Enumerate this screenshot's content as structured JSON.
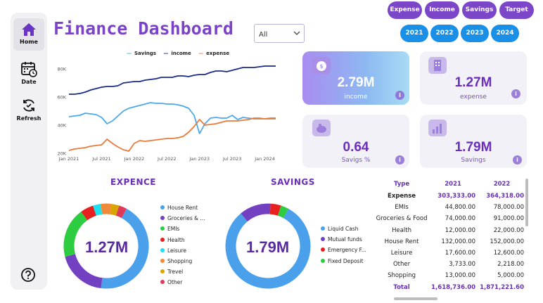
{
  "header": {
    "title": "Finance Dashboard",
    "year_select": "All"
  },
  "sidebar": {
    "items": [
      {
        "label": "Home",
        "icon": "home-icon"
      },
      {
        "label": "Date",
        "icon": "calendar-icon"
      },
      {
        "label": "Refresh",
        "icon": "refresh-icon"
      }
    ],
    "help_icon": "help-icon"
  },
  "nav_buttons": {
    "measures": [
      "Expense",
      "Income",
      "Savings",
      "Target"
    ],
    "years": [
      "2021",
      "2022",
      "2023",
      "2024"
    ]
  },
  "kpis": {
    "income": {
      "value": "2.79M",
      "label": "income"
    },
    "expense": {
      "value": "1.27M",
      "label": "expense"
    },
    "savings_pct": {
      "value": "0.64",
      "label": "Savigs %"
    },
    "savings": {
      "value": "1.79M",
      "label": "Savings"
    }
  },
  "chart_data": [
    {
      "type": "line",
      "title": "",
      "legend": [
        "Savings",
        "income",
        "expense"
      ],
      "colors": {
        "Savings": "#4aa8ec",
        "income": "#1a2b8a",
        "expense": "#ea7a3b"
      },
      "x": [
        "2021-01",
        "2021-02",
        "2021-03",
        "2021-04",
        "2021-05",
        "2021-06",
        "2021-07",
        "2021-08",
        "2021-09",
        "2021-10",
        "2021-11",
        "2021-12",
        "2022-01",
        "2022-02",
        "2022-03",
        "2022-04",
        "2022-05",
        "2022-06",
        "2022-07",
        "2022-08",
        "2022-09",
        "2022-10",
        "2022-11",
        "2022-12",
        "2023-01",
        "2023-02",
        "2023-03",
        "2023-04",
        "2023-05",
        "2023-06",
        "2023-07",
        "2023-08",
        "2023-09",
        "2023-10",
        "2023-11",
        "2023-12",
        "2024-01",
        "2024-02",
        "2024-03"
      ],
      "x_ticks": [
        "Jan 2021",
        "Jul 2021",
        "Jan 2022",
        "Jul 2022",
        "Jan 2023",
        "Jul 2023",
        "Jan 2024"
      ],
      "y_ticks": [
        "20K",
        "40K",
        "60K",
        "80K"
      ],
      "ylim": [
        20000,
        85000
      ],
      "series": [
        {
          "name": "income",
          "values": [
            62000,
            62000,
            62500,
            63500,
            65000,
            66000,
            67000,
            67500,
            67500,
            68000,
            70000,
            70500,
            71000,
            71000,
            72000,
            72500,
            73000,
            74000,
            74000,
            74000,
            75000,
            75000,
            74500,
            75500,
            76000,
            76000,
            77500,
            78500,
            78500,
            78000,
            79000,
            80000,
            81000,
            81000,
            81000,
            81500,
            82000,
            82000,
            82000
          ]
        },
        {
          "name": "Savings",
          "values": [
            46000,
            46500,
            47000,
            48500,
            48000,
            47500,
            45500,
            41000,
            43000,
            46500,
            50000,
            52000,
            53000,
            54000,
            55000,
            56000,
            55500,
            55500,
            55000,
            55000,
            54500,
            53500,
            52000,
            47000,
            34000,
            41000,
            45000,
            45500,
            45000,
            45000,
            47000,
            44000,
            45500,
            45000,
            44500,
            44500,
            44500,
            44500,
            44500
          ]
        },
        {
          "name": "expense",
          "values": [
            22000,
            23000,
            23500,
            24000,
            25000,
            25500,
            26000,
            30000,
            27000,
            24500,
            22500,
            21500,
            27000,
            29000,
            28500,
            29000,
            29500,
            30000,
            30500,
            30500,
            31000,
            32000,
            35000,
            39000,
            44000,
            40000,
            40500,
            41000,
            42000,
            43000,
            43000,
            43000,
            43500,
            44000,
            45000,
            45000,
            44500,
            45000,
            45000
          ]
        }
      ]
    },
    {
      "type": "pie",
      "title": "EXPENCE",
      "center_label": "1.27M",
      "labels": [
        "House Rent",
        "Groceries & ...",
        "EMIs",
        "Health",
        "Leisure",
        "Shopping",
        "Trevel",
        "Other"
      ],
      "values": [
        0.44,
        0.19,
        0.19,
        0.05,
        0.03,
        0.04,
        0.03,
        0.03
      ],
      "colors": [
        "#4aa0ea",
        "#7440c2",
        "#2ecc40",
        "#e82020",
        "#1de1f0",
        "#ef8a3a",
        "#d9a400",
        "#e03a5a"
      ]
    },
    {
      "type": "pie",
      "title": "SAVINGS",
      "center_label": "1.79M",
      "labels": [
        "Liquid Cash",
        "Mutual funds",
        "Emergency F...",
        "Fixed Deposit"
      ],
      "values": [
        0.81,
        0.12,
        0.04,
        0.03
      ],
      "colors": [
        "#4aa0ea",
        "#7440c2",
        "#e82020",
        "#2ecc40"
      ]
    }
  ],
  "table": {
    "headers": [
      "Type",
      "2021",
      "2022"
    ],
    "rows": [
      {
        "type": "Expense",
        "y2021": "303,333.00",
        "y2022": "364,318.00",
        "style": "exp"
      },
      {
        "type": "EMIs",
        "y2021": "44,800.00",
        "y2022": "78,000.00",
        "style": ""
      },
      {
        "type": "Groceries & Food",
        "y2021": "74,000.00",
        "y2022": "91,000.00",
        "style": ""
      },
      {
        "type": "Health",
        "y2021": "12,000.00",
        "y2022": "22,000.00",
        "style": ""
      },
      {
        "type": "House Rent",
        "y2021": "132,000.00",
        "y2022": "152,000.00",
        "style": ""
      },
      {
        "type": "Leisure",
        "y2021": "17,600.00",
        "y2022": "12,600.00",
        "style": ""
      },
      {
        "type": "Other",
        "y2021": "3,733.00",
        "y2022": "2,218.00",
        "style": ""
      },
      {
        "type": "Shopping",
        "y2021": "13,000.00",
        "y2022": "5,000.00",
        "style": ""
      },
      {
        "type": "Total",
        "y2021": "1,618,736.00",
        "y2022": "1,871,221.60",
        "style": "tot"
      }
    ]
  }
}
